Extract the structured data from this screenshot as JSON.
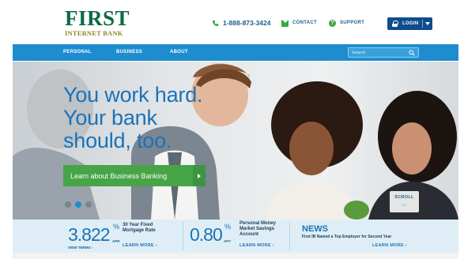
{
  "header": {
    "logo_main": "FIRST",
    "logo_sub": "INTERNET BANK",
    "phone": "1-888-873-3424",
    "contact_label": "CONTACT",
    "support_label": "SUPPORT",
    "login_label": "LOGIN"
  },
  "nav": {
    "items": [
      {
        "label": "PERSONAL"
      },
      {
        "label": "BUSINESS"
      },
      {
        "label": "ABOUT"
      }
    ],
    "search_placeholder": "Search"
  },
  "hero": {
    "headline_lines": [
      "You work hard.",
      "Your bank",
      "should, too."
    ],
    "cta_label": "Learn about Business Banking",
    "scroll_label": "SCROLL",
    "slide_count": 3,
    "active_slide": 2
  },
  "rates": {
    "mortgage": {
      "value": "3.822",
      "percent": "%",
      "unit": "APR",
      "desc_line1": "30 Year Fixed",
      "desc_line2": "Mortgage Rate",
      "view_terms": "VIEW TERMS",
      "learn_more": "LEARN MORE"
    },
    "savings": {
      "value": "0.80",
      "percent": "%",
      "unit": "APY",
      "desc_line1": "Personal Money",
      "desc_line2": "Market Savings",
      "desc_line3": "Account",
      "learn_more": "LEARN MORE"
    },
    "news": {
      "title": "NEWS",
      "text": "First IB Named a Top Employer for Second Year",
      "learn_more": "LEARN MORE"
    }
  },
  "colors": {
    "brand_green": "#0a6b44",
    "nav_blue": "#1d8dcf",
    "login_navy": "#0e4d8c",
    "cta_green": "#47a447",
    "headline_blue": "#1b72b8"
  }
}
